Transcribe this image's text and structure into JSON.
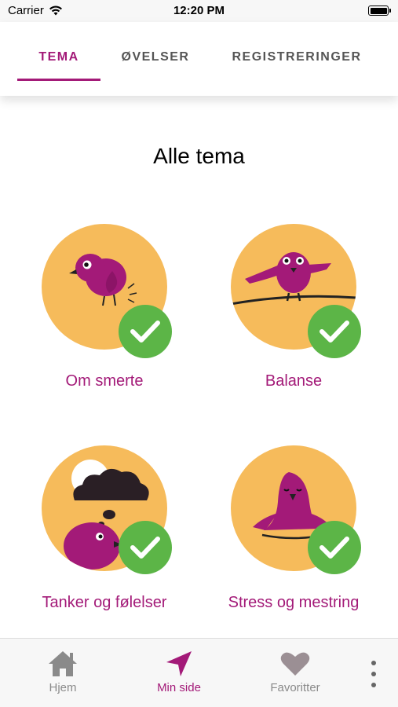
{
  "status_bar": {
    "carrier": "Carrier",
    "time": "12:20 PM"
  },
  "tabs": [
    {
      "label": "TEMA",
      "active": true
    },
    {
      "label": "ØVELSER",
      "active": false
    },
    {
      "label": "REGISTRERINGER",
      "active": false
    }
  ],
  "section_title": "Alle tema",
  "themes": [
    {
      "label": "Om smerte",
      "completed": true,
      "icon": "bird-pecking-icon"
    },
    {
      "label": "Balanse",
      "completed": true,
      "icon": "bird-balancing-icon"
    },
    {
      "label": "Tanker og følelser",
      "completed": true,
      "icon": "bird-cloud-icon"
    },
    {
      "label": "Stress og mestring",
      "completed": true,
      "icon": "bird-meditating-icon"
    }
  ],
  "bottom_nav": [
    {
      "label": "Hjem",
      "icon": "home-icon",
      "active": false
    },
    {
      "label": "Min side",
      "icon": "navigation-arrow-icon",
      "active": true
    },
    {
      "label": "Favoritter",
      "icon": "heart-icon",
      "active": false
    }
  ],
  "colors": {
    "accent": "#a31a78",
    "circle": "#f6bb5b",
    "check": "#5cb547",
    "bird": "#a31a78"
  }
}
